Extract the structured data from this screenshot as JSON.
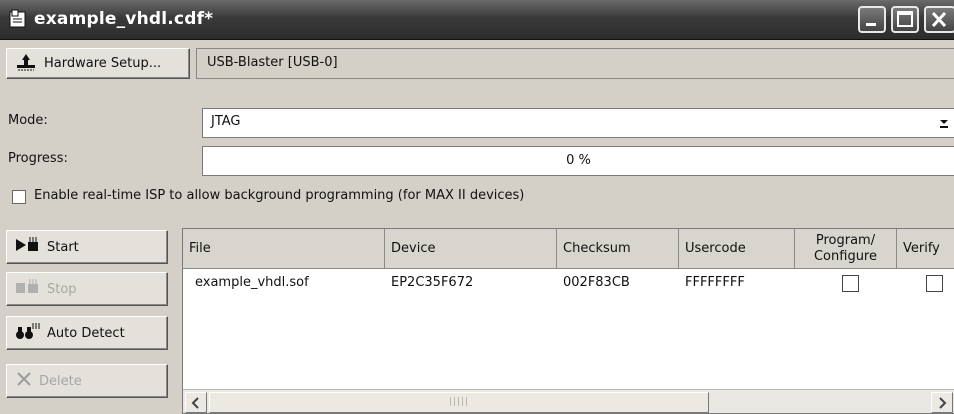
{
  "window": {
    "title": "example_vhdl.cdf*"
  },
  "hardware": {
    "button_label": "Hardware Setup...",
    "value": "USB-Blaster [USB-0]"
  },
  "mode": {
    "label": "Mode:",
    "value": "JTAG"
  },
  "progress": {
    "label": "Progress:",
    "value": "0 %",
    "fraction": 0
  },
  "isp": {
    "label": "Enable real-time ISP to allow background programming (for MAX II devices)",
    "checked": false
  },
  "side_buttons": {
    "start": "Start",
    "stop": "Stop",
    "auto_detect": "Auto Detect",
    "delete": "Delete"
  },
  "table": {
    "columns": [
      "File",
      "Device",
      "Checksum",
      "Usercode",
      "Program/ Configure",
      "Verify"
    ],
    "rows": [
      {
        "file": "example_vhdl.sof",
        "device": "EP2C35F672",
        "checksum": "002F83CB",
        "usercode": "FFFFFFFF",
        "program_configure": false,
        "verify": false
      }
    ]
  },
  "colors": {
    "titlebar": "#3a3a3a",
    "face": "#d4d0c8",
    "disabled_text": "#a6a6a6"
  }
}
